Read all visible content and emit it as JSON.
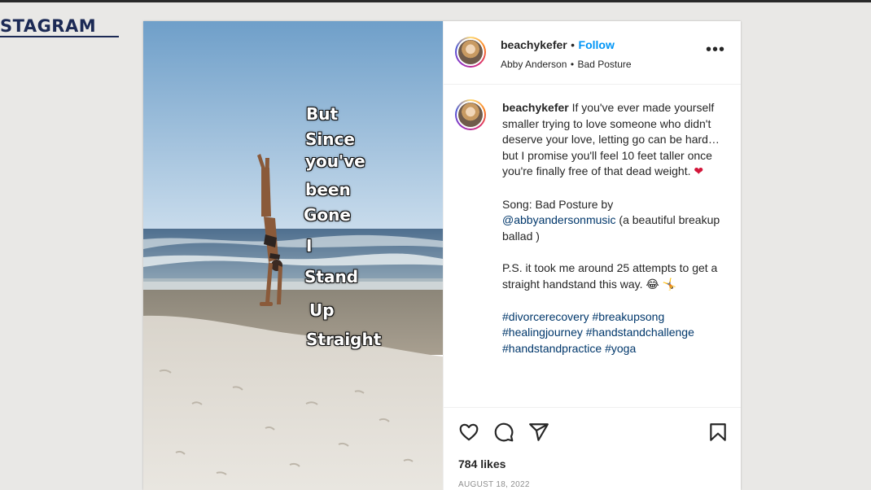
{
  "brand": {
    "text": "STAGRAM"
  },
  "post": {
    "overlay_lines": [
      "But",
      "Since",
      "you've",
      "been",
      "Gone",
      "I",
      "Stand",
      "Up",
      "Straight"
    ],
    "header": {
      "username": "beachykefer",
      "separator": "•",
      "follow_label": "Follow",
      "audio_artist": "Abby Anderson",
      "audio_separator": "•",
      "audio_title": "Bad Posture",
      "more_label": "•••"
    },
    "caption": {
      "username": "beachykefer",
      "text_1": "If you've ever made yourself smaller trying to love someone who didn't deserve your love, letting go can be hard… but I promise you'll feel 10 feet taller once you're finally free of that dead weight.",
      "emoji_1": "❤",
      "song_prefix": "Song: Bad Posture by",
      "song_mention": "@abbyandersonmusic",
      "song_suffix": "(a beautiful breakup ballad )",
      "ps_text": "P.S. it took me around 25 attempts to get a straight handstand this way.",
      "emoji_2": "😂",
      "emoji_3": "🤸",
      "hashtags": [
        "#divorcerecovery",
        "#breakupsong",
        "#healingjourney",
        "#handstandchallenge",
        "#handstandpractice",
        "#yoga"
      ]
    },
    "likes_label": "784 likes",
    "date_label": "AUGUST 18, 2022"
  },
  "icons": [
    "heart-icon",
    "comment-icon",
    "share-icon",
    "bookmark-icon",
    "more-icon"
  ]
}
